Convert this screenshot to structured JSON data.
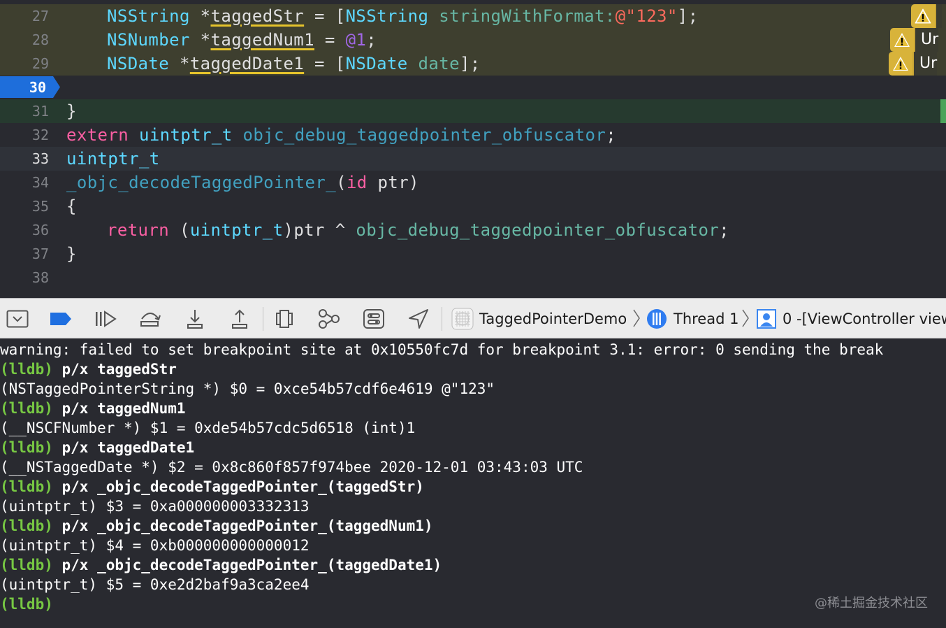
{
  "editor": {
    "lines": [
      {
        "num": "27"
      },
      {
        "num": "28"
      },
      {
        "num": "29"
      },
      {
        "num": "30"
      },
      {
        "num": "31"
      },
      {
        "num": "32"
      },
      {
        "num": "33"
      },
      {
        "num": "34"
      },
      {
        "num": "35"
      },
      {
        "num": "36"
      },
      {
        "num": "37"
      },
      {
        "num": "38"
      }
    ],
    "tokens": {
      "l27": [
        "NSString",
        " *",
        "taggedStr",
        " = [",
        "NSString",
        " ",
        "stringWithFormat:",
        "@\"123\"",
        "];"
      ],
      "l28": [
        "NSNumber",
        " *",
        "taggedNum1",
        " = ",
        "@1",
        ";"
      ],
      "l29": [
        "NSDate",
        " *",
        "taggedDate1",
        " = [",
        "NSDate",
        " ",
        "date",
        "];"
      ],
      "l31": [
        "}"
      ],
      "l32": [
        "extern",
        " ",
        "uintptr_t",
        " ",
        "objc_debug_taggedpointer_obfuscator",
        ";"
      ],
      "l33": [
        "uintptr_t"
      ],
      "l34": [
        "_objc_decodeTaggedPointer_",
        "(",
        "id",
        " ptr)"
      ],
      "l35": [
        "{"
      ],
      "l36": [
        "return",
        " (",
        "uintptr_t",
        ")ptr ^ ",
        "objc_debug_taggedpointer_obfuscator",
        ";"
      ],
      "l37": [
        "}"
      ]
    },
    "warnings": [
      {
        "text": ""
      },
      {
        "text": "Ur"
      },
      {
        "text": "Ur"
      }
    ]
  },
  "debugbar": {
    "scheme": "TaggedPointerDemo",
    "thread": "Thread 1",
    "frame": "0 -[ViewController view"
  },
  "console": {
    "warning": "warning: failed to set breakpoint site at 0x10550fc7d for breakpoint 3.1: error: 0 sending the break",
    "prompt": "(lldb)",
    "entries": [
      {
        "cmd": " p/x taggedStr",
        "out": "(NSTaggedPointerString *) $0 = 0xce54b57cdf6e4619 @\"123\""
      },
      {
        "cmd": " p/x taggedNum1",
        "out": "(__NSCFNumber *) $1 = 0xde54b57cdc5d6518 (int)1"
      },
      {
        "cmd": " p/x taggedDate1",
        "out": "(__NSTaggedDate *) $2 = 0x8c860f857f974bee 2020-12-01 03:43:03 UTC"
      },
      {
        "cmd": " p/x _objc_decodeTaggedPointer_(taggedStr)",
        "out": "(uintptr_t) $3 = 0xa000000003332313"
      },
      {
        "cmd": " p/x _objc_decodeTaggedPointer_(taggedNum1)",
        "out": "(uintptr_t) $4 = 0xb000000000000012"
      },
      {
        "cmd": " p/x _objc_decodeTaggedPointer_(taggedDate1)",
        "out": "(uintptr_t) $5 = 0xe2d2baf9a3ca2ee4"
      }
    ],
    "watermark": "@稀土掘金技术社区"
  },
  "colors": {
    "keyword": "#fc5fa3",
    "type": "#5dd8ff",
    "function": "#67b7a4",
    "prompt": "#77c843",
    "pc_arrow": "#1e6edb",
    "warning": "#d8b33a"
  }
}
